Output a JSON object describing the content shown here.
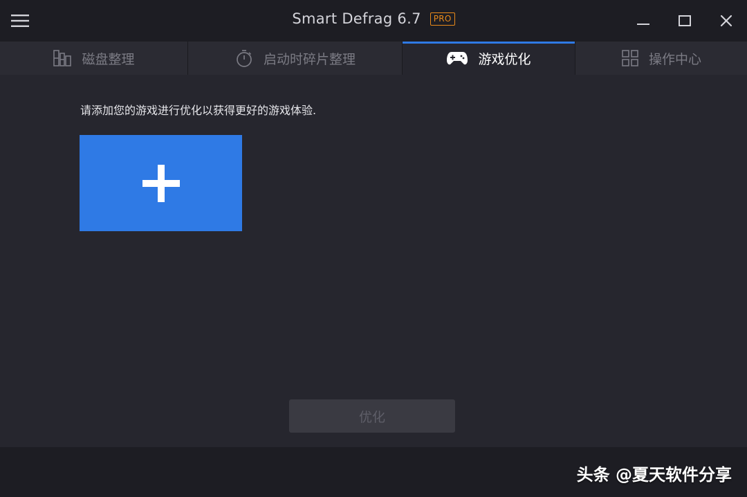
{
  "window": {
    "title": "Smart Defrag 6.7",
    "badge": "PRO",
    "controls": {
      "menu": "hamburger-menu-icon",
      "minimize": "minimize-icon",
      "maximize": "maximize-icon",
      "close": "close-icon"
    }
  },
  "tabs": [
    {
      "label": "磁盘整理",
      "icon": "disk-defrag-icon",
      "active": false
    },
    {
      "label": "启动时碎片整理",
      "icon": "stopwatch-icon",
      "active": false
    },
    {
      "label": "游戏优化",
      "icon": "gamepad-icon",
      "active": true
    },
    {
      "label": "操作中心",
      "icon": "grid-icon",
      "active": false
    }
  ],
  "main": {
    "hint": "请添加您的游戏进行优化以获得更好的游戏体验.",
    "add_tile_icon": "plus-icon",
    "optimize_button": "优化"
  },
  "footer": {
    "watermark": "头条 @夏天软件分享"
  },
  "colors": {
    "accent": "#2f7ae5",
    "pro_badge": "#e98a1a",
    "background": "#26262e",
    "titlebar": "#1d1d23"
  }
}
